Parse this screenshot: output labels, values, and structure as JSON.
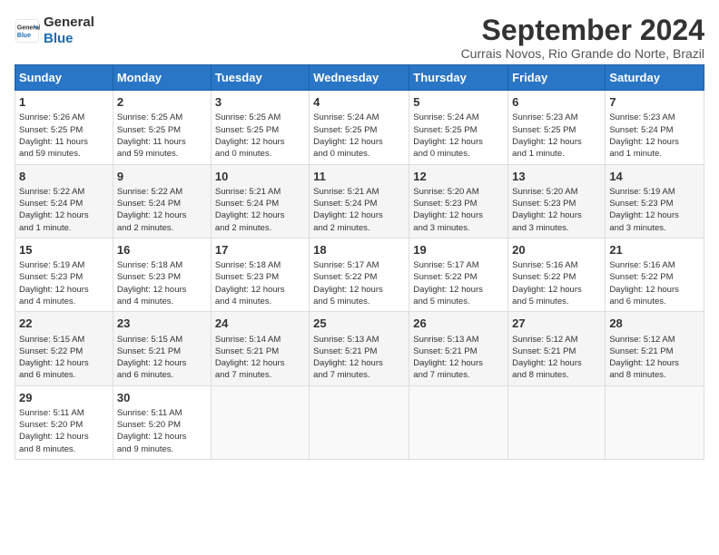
{
  "header": {
    "logo_line1": "General",
    "logo_line2": "Blue",
    "title": "September 2024",
    "location": "Currais Novos, Rio Grande do Norte, Brazil"
  },
  "days_of_week": [
    "Sunday",
    "Monday",
    "Tuesday",
    "Wednesday",
    "Thursday",
    "Friday",
    "Saturday"
  ],
  "weeks": [
    [
      {
        "day": "1",
        "info": "Sunrise: 5:26 AM\nSunset: 5:25 PM\nDaylight: 11 hours\nand 59 minutes."
      },
      {
        "day": "2",
        "info": "Sunrise: 5:25 AM\nSunset: 5:25 PM\nDaylight: 11 hours\nand 59 minutes."
      },
      {
        "day": "3",
        "info": "Sunrise: 5:25 AM\nSunset: 5:25 PM\nDaylight: 12 hours\nand 0 minutes."
      },
      {
        "day": "4",
        "info": "Sunrise: 5:24 AM\nSunset: 5:25 PM\nDaylight: 12 hours\nand 0 minutes."
      },
      {
        "day": "5",
        "info": "Sunrise: 5:24 AM\nSunset: 5:25 PM\nDaylight: 12 hours\nand 0 minutes."
      },
      {
        "day": "6",
        "info": "Sunrise: 5:23 AM\nSunset: 5:25 PM\nDaylight: 12 hours\nand 1 minute."
      },
      {
        "day": "7",
        "info": "Sunrise: 5:23 AM\nSunset: 5:24 PM\nDaylight: 12 hours\nand 1 minute."
      }
    ],
    [
      {
        "day": "8",
        "info": "Sunrise: 5:22 AM\nSunset: 5:24 PM\nDaylight: 12 hours\nand 1 minute."
      },
      {
        "day": "9",
        "info": "Sunrise: 5:22 AM\nSunset: 5:24 PM\nDaylight: 12 hours\nand 2 minutes."
      },
      {
        "day": "10",
        "info": "Sunrise: 5:21 AM\nSunset: 5:24 PM\nDaylight: 12 hours\nand 2 minutes."
      },
      {
        "day": "11",
        "info": "Sunrise: 5:21 AM\nSunset: 5:24 PM\nDaylight: 12 hours\nand 2 minutes."
      },
      {
        "day": "12",
        "info": "Sunrise: 5:20 AM\nSunset: 5:23 PM\nDaylight: 12 hours\nand 3 minutes."
      },
      {
        "day": "13",
        "info": "Sunrise: 5:20 AM\nSunset: 5:23 PM\nDaylight: 12 hours\nand 3 minutes."
      },
      {
        "day": "14",
        "info": "Sunrise: 5:19 AM\nSunset: 5:23 PM\nDaylight: 12 hours\nand 3 minutes."
      }
    ],
    [
      {
        "day": "15",
        "info": "Sunrise: 5:19 AM\nSunset: 5:23 PM\nDaylight: 12 hours\nand 4 minutes."
      },
      {
        "day": "16",
        "info": "Sunrise: 5:18 AM\nSunset: 5:23 PM\nDaylight: 12 hours\nand 4 minutes."
      },
      {
        "day": "17",
        "info": "Sunrise: 5:18 AM\nSunset: 5:23 PM\nDaylight: 12 hours\nand 4 minutes."
      },
      {
        "day": "18",
        "info": "Sunrise: 5:17 AM\nSunset: 5:22 PM\nDaylight: 12 hours\nand 5 minutes."
      },
      {
        "day": "19",
        "info": "Sunrise: 5:17 AM\nSunset: 5:22 PM\nDaylight: 12 hours\nand 5 minutes."
      },
      {
        "day": "20",
        "info": "Sunrise: 5:16 AM\nSunset: 5:22 PM\nDaylight: 12 hours\nand 5 minutes."
      },
      {
        "day": "21",
        "info": "Sunrise: 5:16 AM\nSunset: 5:22 PM\nDaylight: 12 hours\nand 6 minutes."
      }
    ],
    [
      {
        "day": "22",
        "info": "Sunrise: 5:15 AM\nSunset: 5:22 PM\nDaylight: 12 hours\nand 6 minutes."
      },
      {
        "day": "23",
        "info": "Sunrise: 5:15 AM\nSunset: 5:21 PM\nDaylight: 12 hours\nand 6 minutes."
      },
      {
        "day": "24",
        "info": "Sunrise: 5:14 AM\nSunset: 5:21 PM\nDaylight: 12 hours\nand 7 minutes."
      },
      {
        "day": "25",
        "info": "Sunrise: 5:13 AM\nSunset: 5:21 PM\nDaylight: 12 hours\nand 7 minutes."
      },
      {
        "day": "26",
        "info": "Sunrise: 5:13 AM\nSunset: 5:21 PM\nDaylight: 12 hours\nand 7 minutes."
      },
      {
        "day": "27",
        "info": "Sunrise: 5:12 AM\nSunset: 5:21 PM\nDaylight: 12 hours\nand 8 minutes."
      },
      {
        "day": "28",
        "info": "Sunrise: 5:12 AM\nSunset: 5:21 PM\nDaylight: 12 hours\nand 8 minutes."
      }
    ],
    [
      {
        "day": "29",
        "info": "Sunrise: 5:11 AM\nSunset: 5:20 PM\nDaylight: 12 hours\nand 8 minutes."
      },
      {
        "day": "30",
        "info": "Sunrise: 5:11 AM\nSunset: 5:20 PM\nDaylight: 12 hours\nand 9 minutes."
      },
      null,
      null,
      null,
      null,
      null
    ]
  ]
}
